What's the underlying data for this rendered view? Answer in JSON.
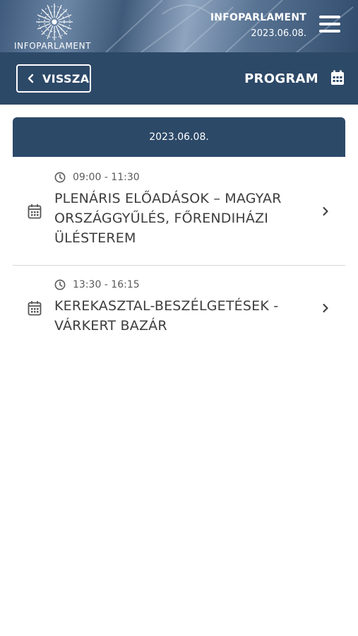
{
  "header": {
    "logo_text": "INFOPARLAMENT",
    "app_title": "INFOPARLAMENT",
    "date": "2023.06.08."
  },
  "navbar": {
    "back_label": "VISSZA",
    "title": "PROGRAM"
  },
  "program": {
    "date": "2023.06.08.",
    "items": [
      {
        "time": "09:00 - 11:30",
        "title": "PLENÁRIS ELŐADÁSOK – MAGYAR ORSZÁGGYŰLÉS, FŐRENDIHÁZI ÜLÉSTEREM"
      },
      {
        "time": "13:30 - 16:15",
        "title": "KEREKASZTAL-BESZÉLGETÉSEK - VÁRKERT BAZÁR"
      }
    ]
  },
  "icons": {
    "menu": "hamburger-icon",
    "back": "chevron-left-icon",
    "calendar": "calendar-icon",
    "clock": "clock-icon",
    "row_arrow": "chevron-right-icon"
  },
  "colors": {
    "primary": "#2d4968",
    "text": "#3d3d3d",
    "divider": "#d9d9d9"
  }
}
